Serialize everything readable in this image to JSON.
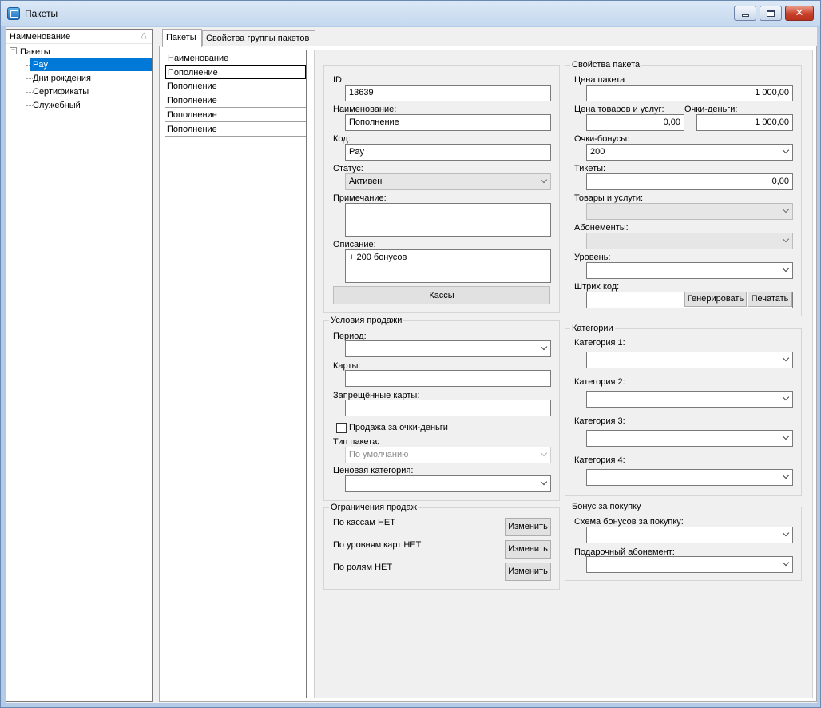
{
  "window": {
    "title": "Пакеты"
  },
  "tree": {
    "header": "Наименование",
    "root": "Пакеты",
    "items": [
      "Pay",
      "Дни рождения",
      "Сертификаты",
      "Служебный"
    ]
  },
  "tabs": [
    "Пакеты",
    "Свойства группы пакетов"
  ],
  "list": {
    "header": "Наименование",
    "rows": [
      "Пополнение",
      "Пополнение",
      "Пополнение",
      "Пополнение",
      "Пополнение"
    ]
  },
  "general": {
    "id_label": "ID:",
    "id_value": "13639",
    "name_label": "Наименование:",
    "name_value": "Пополнение",
    "code_label": "Код:",
    "code_value": "Pay",
    "status_label": "Статус:",
    "status_value": "Активен",
    "note_label": "Примечание:",
    "note_value": "",
    "desc_label": "Описание:",
    "desc_value": "+ 200 бонусов",
    "kassy_button": "Кассы"
  },
  "sale_conditions": {
    "title": "Условия продажи",
    "period_label": "Период:",
    "period_value": "",
    "cards_label": "Карты:",
    "cards_value": "",
    "forbidden_label": "Запрещённые карты:",
    "forbidden_value": "",
    "points_checkbox": "Продажа за очки-деньги",
    "points_checked": false,
    "type_label": "Тип пакета:",
    "type_value": "По умолчанию",
    "price_cat_label": "Ценовая категория:",
    "price_cat_value": ""
  },
  "restrictions": {
    "title": "Ограничения продаж",
    "rows": [
      {
        "label": "По кассам НЕТ",
        "button": "Изменить"
      },
      {
        "label": "По уровням карт НЕТ",
        "button": "Изменить"
      },
      {
        "label": "По ролям НЕТ",
        "button": "Изменить"
      }
    ]
  },
  "package_props": {
    "title": "Свойства пакета",
    "price_label": "Цена пакета",
    "price_value": "1 000,00",
    "goods_price_label": "Цена товаров и услуг:",
    "goods_price_value": "0,00",
    "points_money_label": "Очки-деньги:",
    "points_money_value": "1 000,00",
    "bonus_label": "Очки-бонусы:",
    "bonus_value": "200",
    "tickets_label": "Тикеты:",
    "tickets_value": "0,00",
    "goods_label": "Товары и услуги:",
    "goods_value": "",
    "subs_label": "Абонементы:",
    "subs_value": "",
    "level_label": "Уровень:",
    "level_value": "",
    "barcode_label": "Штрих код:",
    "barcode_value": "",
    "generate_button": "Генерировать",
    "print_button": "Печатать"
  },
  "categories": {
    "title": "Категории",
    "items": [
      {
        "label": "Категория 1:",
        "value": ""
      },
      {
        "label": "Категория 2:",
        "value": ""
      },
      {
        "label": "Категория 3:",
        "value": ""
      },
      {
        "label": "Категория 4:",
        "value": ""
      }
    ]
  },
  "bonus": {
    "title": "Бонус за покупку",
    "scheme_label": "Схема бонусов за покупку:",
    "scheme_value": "",
    "gift_label": "Подарочный абонемент:",
    "gift_value": ""
  }
}
